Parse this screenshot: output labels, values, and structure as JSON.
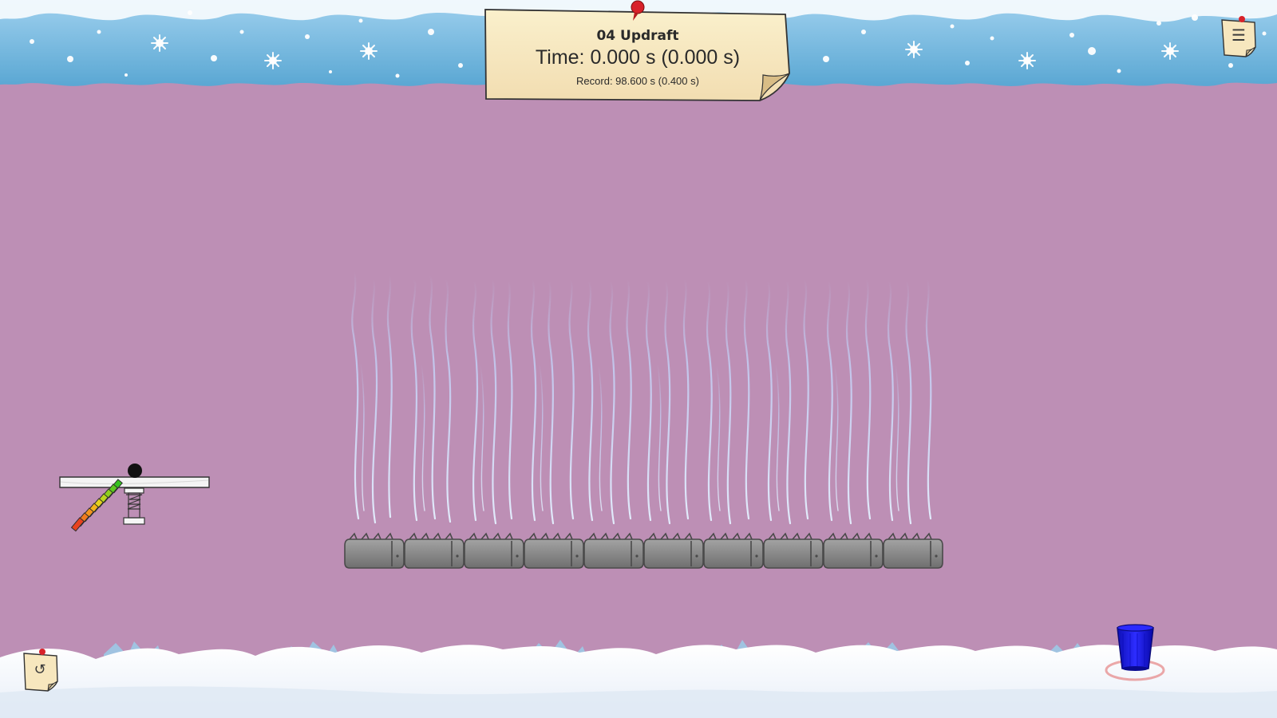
{
  "level": {
    "title": "04 Updraft",
    "time": "Time: 0.000 s  (0.000 s)",
    "record": "Record: 98.600 s  (0.400 s)"
  },
  "buttons": {
    "menu_glyph": "☰",
    "reset_glyph": "↺"
  },
  "colors": {
    "background": "#bd8fb5",
    "sky": "#78b6da",
    "snow": "#f4f8fc",
    "note_paper": "#f6e6be",
    "pin_red": "#d8212a",
    "fan_block": "#8a8a8a",
    "air_stream": "#d8e8ff",
    "bucket": "#1616d8",
    "ball": "#111111"
  },
  "scene": {
    "fan_count": 10,
    "launcher_gradient": [
      "#e8421e",
      "#f07a1e",
      "#f3b51b",
      "#c9d51e",
      "#35c21e"
    ],
    "icons": [
      "pushpin-icon",
      "snowflake-icon",
      "bush-icon",
      "bucket-icon",
      "ball-icon",
      "spring-icon"
    ]
  }
}
